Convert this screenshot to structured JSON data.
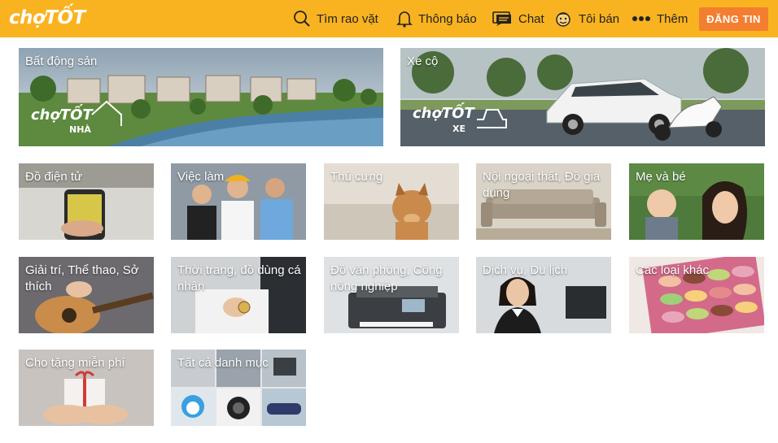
{
  "header": {
    "logo": "chợTỐT",
    "nav": [
      {
        "label": "Tìm rao vặt",
        "icon": "search-icon"
      },
      {
        "label": "Thông báo",
        "icon": "bell-icon"
      },
      {
        "label": "Chat",
        "icon": "chat-icon"
      },
      {
        "label": "Tôi bán",
        "icon": "seller-face-icon"
      },
      {
        "label": "Thêm",
        "icon": "more-dots-icon"
      }
    ],
    "post_label": "ĐĂNG TIN"
  },
  "featured": [
    {
      "label": "Bất động sản",
      "brand": "chợTỐT",
      "brand_sub": "NHÀ"
    },
    {
      "label": "Xe cộ",
      "brand": "chợTỐT",
      "brand_sub": "XE"
    }
  ],
  "categories": [
    {
      "label": "Đồ điện tử"
    },
    {
      "label": "Việc làm"
    },
    {
      "label": "Thú cưng"
    },
    {
      "label": "Nội ngoại thất, Đồ gia dụng"
    },
    {
      "label": "Mẹ và bé"
    },
    {
      "label": "Giải trí, Thể thao, Sở thích"
    },
    {
      "label": "Thời trang, đồ dùng cá nhân"
    },
    {
      "label": "Đồ văn phòng, Công nông nghiệp"
    },
    {
      "label": "Dịch vụ, Du lịch"
    },
    {
      "label": "Các loại khác"
    },
    {
      "label": "Cho tặng miễn phí"
    },
    {
      "label": "Tất cả danh mục"
    }
  ],
  "colors": {
    "header_bg": "#f9b320",
    "post_button": "#f47e30"
  }
}
